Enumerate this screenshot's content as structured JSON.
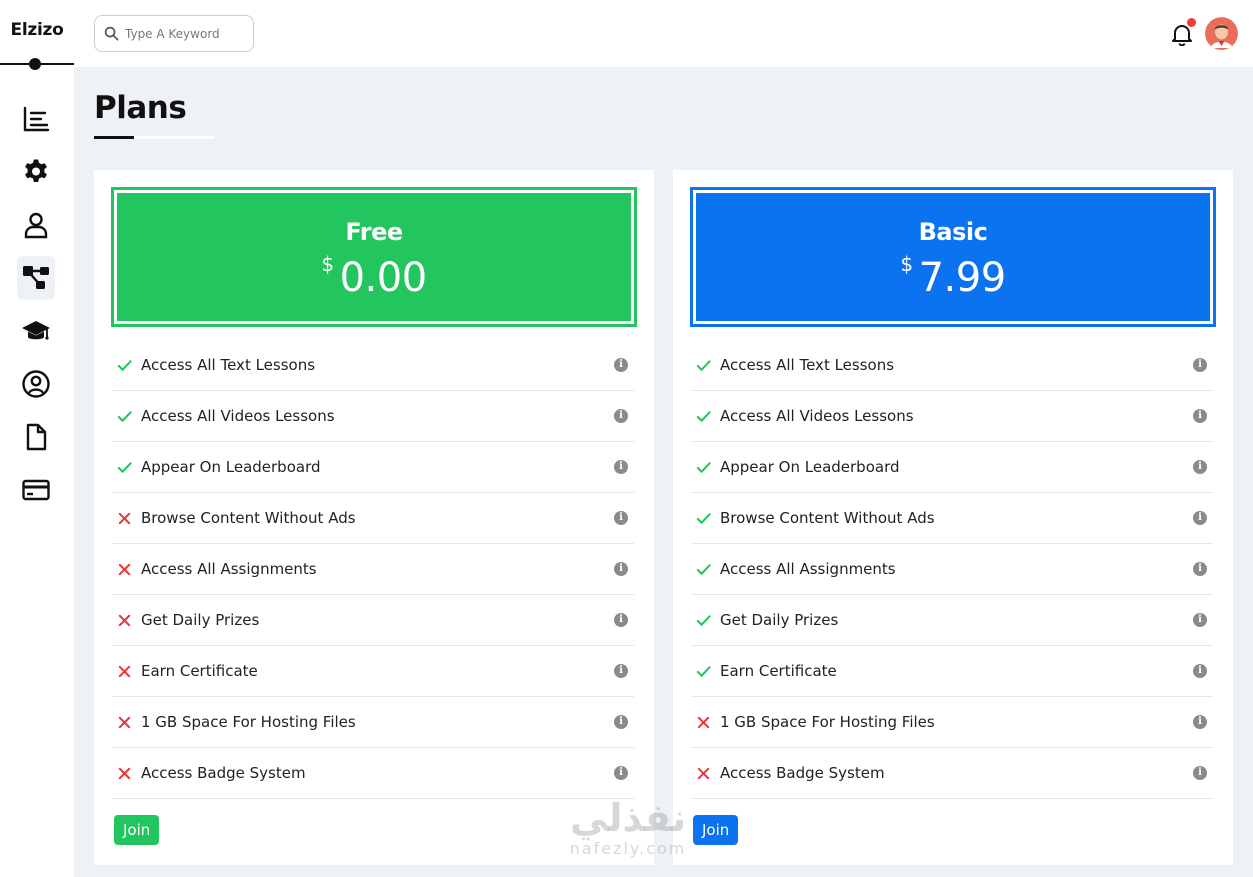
{
  "app": {
    "brand": "Elzizo"
  },
  "search": {
    "placeholder": "Type A Keyword"
  },
  "page": {
    "title": "Plans"
  },
  "colors": {
    "check": "#22c55e",
    "cross": "#e53935"
  },
  "sidebar": {
    "items": [
      {
        "icon": "dashboard-icon",
        "active": false
      },
      {
        "icon": "settings-icon",
        "active": false
      },
      {
        "icon": "profile-icon",
        "active": false
      },
      {
        "icon": "projects-icon",
        "active": true
      },
      {
        "icon": "courses-icon",
        "active": false
      },
      {
        "icon": "friends-icon",
        "active": false
      },
      {
        "icon": "files-icon",
        "active": false
      },
      {
        "icon": "plans-icon",
        "active": false
      }
    ]
  },
  "plans": [
    {
      "name": "Free",
      "currency": "$",
      "price": "0.00",
      "color": "#22c55e",
      "join_label": "Join",
      "features": [
        {
          "label": "Access All Text Lessons",
          "included": true
        },
        {
          "label": "Access All Videos Lessons",
          "included": true
        },
        {
          "label": "Appear On Leaderboard",
          "included": true
        },
        {
          "label": "Browse Content Without Ads",
          "included": false
        },
        {
          "label": "Access All Assignments",
          "included": false
        },
        {
          "label": "Get Daily Prizes",
          "included": false
        },
        {
          "label": "Earn Certificate",
          "included": false
        },
        {
          "label": "1 GB Space For Hosting Files",
          "included": false
        },
        {
          "label": "Access Badge System",
          "included": false
        }
      ]
    },
    {
      "name": "Basic",
      "currency": "$",
      "price": "7.99",
      "color": "#0b73f0",
      "join_label": "Join",
      "features": [
        {
          "label": "Access All Text Lessons",
          "included": true
        },
        {
          "label": "Access All Videos Lessons",
          "included": true
        },
        {
          "label": "Appear On Leaderboard",
          "included": true
        },
        {
          "label": "Browse Content Without Ads",
          "included": true
        },
        {
          "label": "Access All Assignments",
          "included": true
        },
        {
          "label": "Get Daily Prizes",
          "included": true
        },
        {
          "label": "Earn Certificate",
          "included": true
        },
        {
          "label": "1 GB Space For Hosting Files",
          "included": false
        },
        {
          "label": "Access Badge System",
          "included": false
        }
      ]
    }
  ],
  "watermark": {
    "arabic": "نفذلي",
    "latin": "nafezly.com"
  }
}
